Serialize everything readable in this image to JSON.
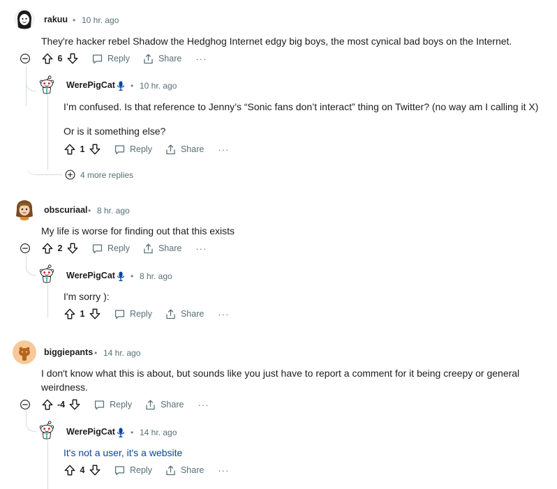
{
  "colors": {
    "link": "#0a449b",
    "muted": "#576f76",
    "thread_line": "#d6dadc",
    "mod_badge": "#0a449b"
  },
  "actions": {
    "reply": "Reply",
    "share": "Share",
    "more": "···",
    "separator": "•"
  },
  "comments": [
    {
      "username": "rakuu",
      "time": "10 hr. ago",
      "text": "They're hacker rebel Shadow the Hedghog Internet edgy big boys, the most cynical bad boys on the Internet.",
      "score": "6",
      "reply": {
        "username": "WerePigCat",
        "time": "10 hr. ago",
        "text_line1": "I’m confused. Is that reference to Jenny’s “Sonic fans don’t interact” thing on Twitter? (no way am I calling it X)",
        "text_line2": "Or is it something else?",
        "score": "1"
      },
      "more_replies": "4 more replies"
    },
    {
      "username": "obscuriaal",
      "time": "8 hr. ago",
      "text": "My life is worse for finding out that this exists",
      "score": "2",
      "reply": {
        "username": "WerePigCat",
        "time": "8 hr. ago",
        "text_line1": "I'm sorry ):",
        "score": "1"
      }
    },
    {
      "username": "biggiepants",
      "time": "14 hr. ago",
      "text_line1": "I don't know what this is about, but sounds like you just have to report a comment for it being creepy or general",
      "text_line2": "weirdness.",
      "score": "-4",
      "reply": {
        "username": "WerePigCat",
        "time": "14 hr. ago",
        "text_line1": "It's not a user, it's a website",
        "score": "4"
      }
    }
  ]
}
